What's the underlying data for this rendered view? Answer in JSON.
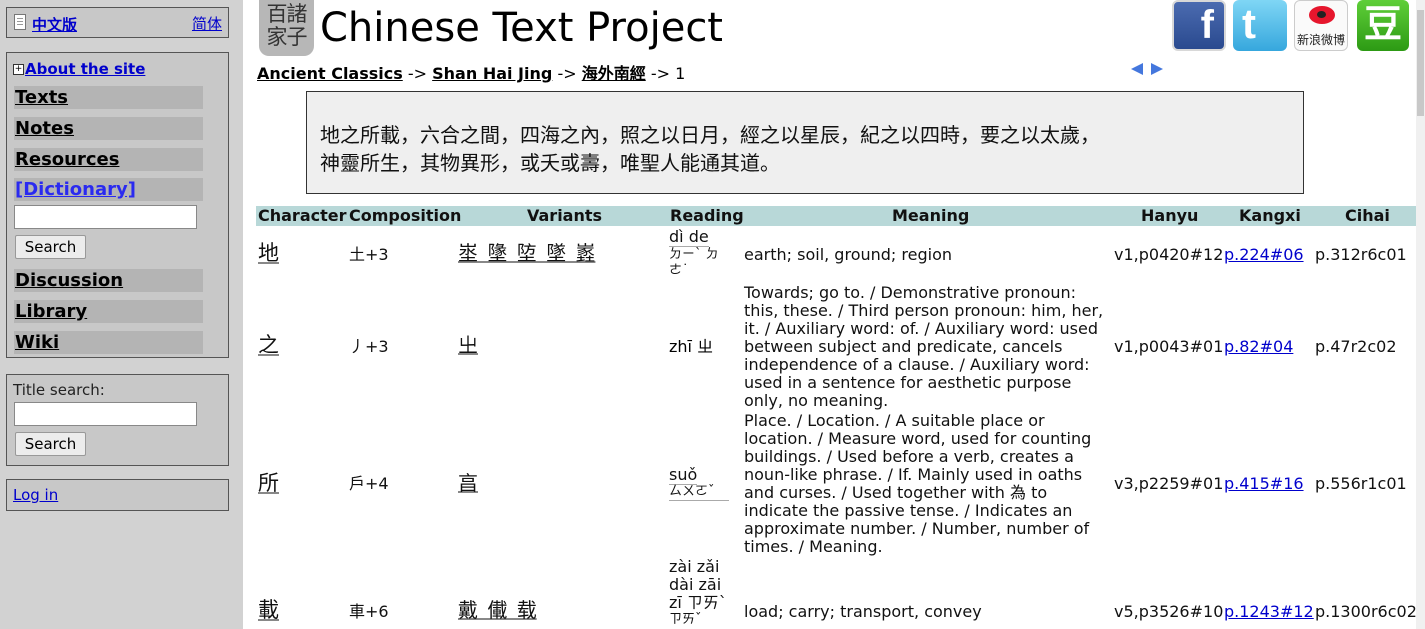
{
  "sidebar": {
    "lang_zh": "中文版",
    "lang_simp": "简体",
    "about": "About the site",
    "nav": [
      "Texts",
      "Notes",
      "Resources",
      "[Dictionary]",
      "Discussion",
      "Library",
      "Wiki"
    ],
    "search_button": "Search",
    "title_search_label": "Title search:",
    "title_search_button": "Search",
    "login": "Log in"
  },
  "header": {
    "seal_text": "百諸家子",
    "title": "Chinese Text Project",
    "social": {
      "facebook_glyph": "f",
      "twitter_glyph": "t",
      "weibo_label": "新浪微博",
      "douban_glyph": "豆"
    }
  },
  "breadcrumb": {
    "items": [
      "Ancient Classics",
      "Shan Hai Jing",
      "海外南經"
    ],
    "sep": "->",
    "last": "1"
  },
  "passage": {
    "line1": "地之所載，六合之間，四海之內，照之以日月，經之以星辰，紀之以四時，要之以太歲，",
    "line2": "神靈所生，其物異形，或夭或壽，唯聖人能通其道。"
  },
  "table": {
    "headers": [
      "Character",
      "Composition",
      "Variants",
      "Reading",
      "Meaning",
      "Hanyu",
      "Kangxi",
      "Cihai"
    ],
    "rows": [
      {
        "char": "地",
        "comp": "土+3",
        "variants": "埊 墬 埅 墜 嶳",
        "reading": "dì de",
        "bopomofo": "ㄉㄧˋ ㄉㄜ˙",
        "meaning": "earth; soil, ground; region",
        "hanyu": "v1,p0420#12",
        "kangxi": "p.224#06",
        "cihai": "p.312r6c01"
      },
      {
        "char": "之",
        "comp": "丿+3",
        "variants": "㞢",
        "reading": "zhī ㄓ",
        "bopomofo": "",
        "meaning": "Towards; go to. / Demonstrative pronoun: this, these. / Third person pronoun: him, her, it. / Auxiliary word: of. / Auxiliary word: used between subject and predicate, cancels independence of a clause. / Auxiliary word: used in a sentence for aesthetic purpose only, no meaning.",
        "hanyu": "v1,p0043#01",
        "kangxi": "p.82#04",
        "cihai": "p.47r2c02"
      },
      {
        "char": "所",
        "comp": "戶+4",
        "variants": "亯",
        "reading": "suǒ",
        "bopomofo": "ㄙㄨㄛˇ",
        "meaning": "Place. / Location. / A suitable place or location. / Measure word, used for counting buildings. / Used before a verb, creates a noun-like phrase. / If. Mainly used in oaths and curses. / Used together with 為 to indicate the passive tense. / Indicates an approximate number. / Number, number of times. / Meaning.",
        "hanyu": "v3,p2259#01",
        "kangxi": "p.415#16",
        "cihai": "p.556r1c01"
      },
      {
        "char": "載",
        "comp": "車+6",
        "variants": "戴 儎 载",
        "reading": "zài zǎi\ndài zāi\nzī ㄗㄞˋ",
        "bopomofo": "ㄗㄞˇ",
        "meaning": "load; carry; transport, convey",
        "hanyu": "v5,p3526#10",
        "kangxi": "p.1243#12",
        "cihai": "p.1300r6c02"
      }
    ]
  }
}
